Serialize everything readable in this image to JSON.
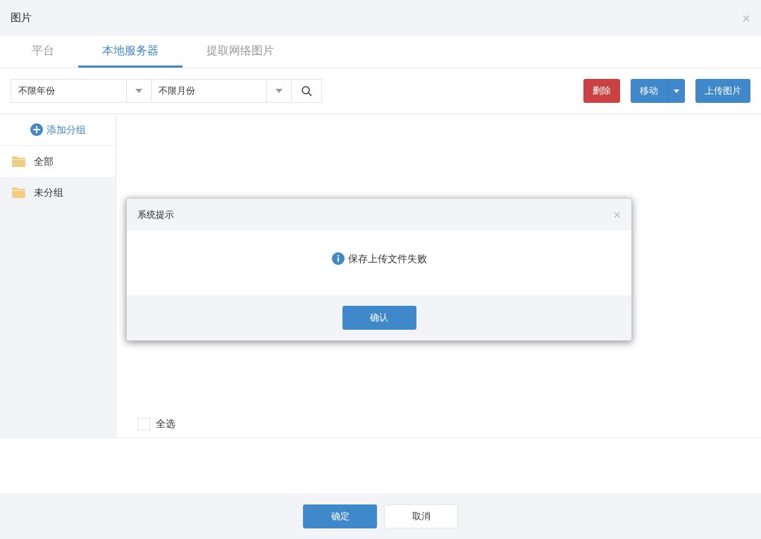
{
  "window": {
    "title": "图片",
    "close": "×"
  },
  "tabs": [
    {
      "label": "平台",
      "selected": false
    },
    {
      "label": "本地服务器",
      "selected": true
    },
    {
      "label": "提取网络图片",
      "selected": false
    }
  ],
  "filters": [
    {
      "value": "不限年份"
    },
    {
      "value": "不限月份"
    }
  ],
  "actions": [
    {
      "label": "删除",
      "kind": "danger"
    },
    {
      "label": "移动",
      "kind": "split"
    },
    {
      "label": "上传图片",
      "kind": "primary"
    }
  ],
  "sidebar": {
    "add_label": "添加分组",
    "items": [
      {
        "label": "全部",
        "selected": true
      },
      {
        "label": "未分组",
        "selected": false
      }
    ]
  },
  "select_all": {
    "label": "全选",
    "checked": false
  },
  "footer_buttons": [
    {
      "label": "确定",
      "kind": "primary"
    },
    {
      "label": "取消",
      "kind": "default"
    }
  ],
  "dialog": {
    "title": "系统提示",
    "close": "×",
    "message": "保存上传文件失败",
    "button": "确认"
  }
}
